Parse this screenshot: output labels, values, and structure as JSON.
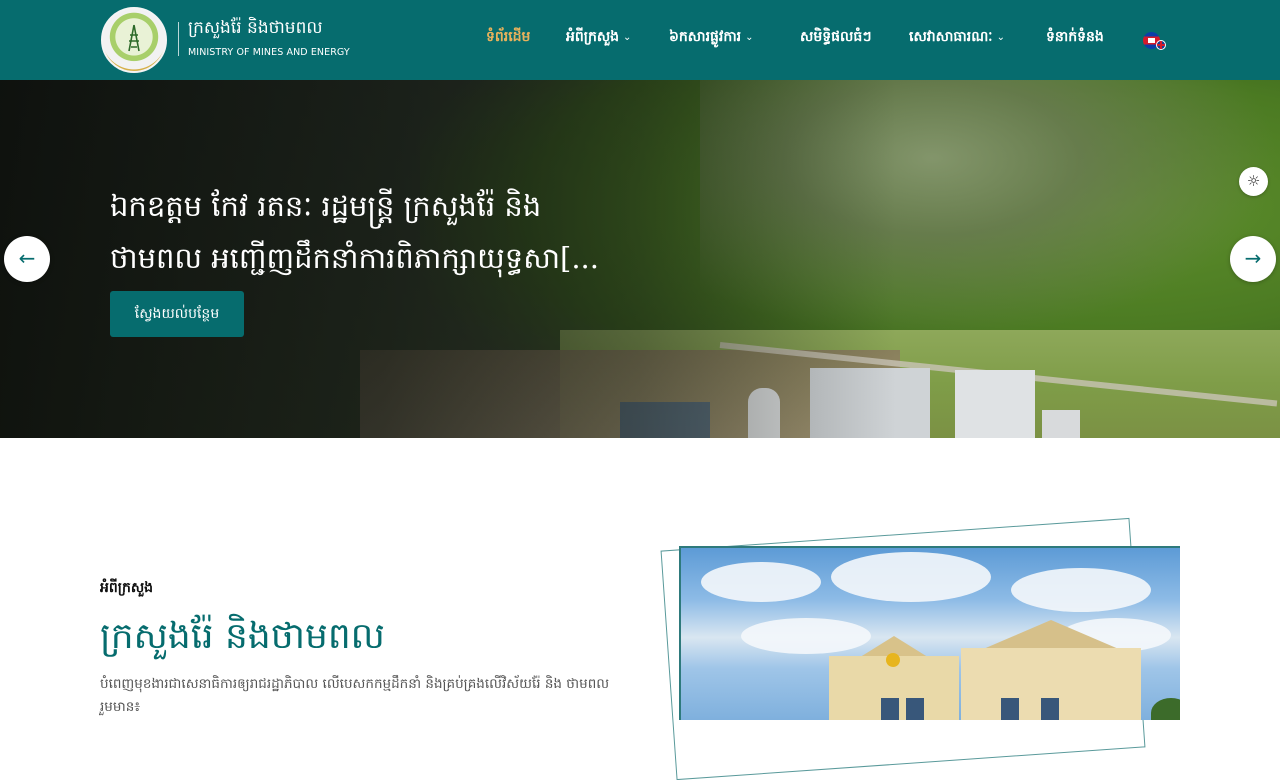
{
  "header": {
    "logo_kh": "ក្រសួងរ៉ែ និងថាមពល",
    "logo_en": "MINISTRY OF MINES AND ENERGY",
    "nav": [
      {
        "label": "ទំព័រដើម",
        "active": true,
        "dropdown": false
      },
      {
        "label": "អំពីក្រសួង",
        "active": false,
        "dropdown": true
      },
      {
        "label": "៦កសារផ្លូវការ",
        "active": false,
        "dropdown": true
      },
      {
        "label": "សមិទ្ធិផលធំៗ",
        "active": false,
        "dropdown": false
      },
      {
        "label": "សេវាសាធារណៈ",
        "active": false,
        "dropdown": true
      },
      {
        "label": "ទំនាក់ទំនង",
        "active": false,
        "dropdown": false
      }
    ],
    "language_icon": "cambodia-uk-flag-icon",
    "colors": {
      "primary": "#066c6e",
      "active_nav": "#e8b25c"
    }
  },
  "hero": {
    "title_line1": "ឯកឧត្តម កែវ រតនៈ រដ្ឋមន្ត្រី ក្រសួងរ៉ែ និង",
    "title_line2": "ថាមពល អញ្ជើញដឹកនាំការពិភាក្សាយុទ្ធសា[...",
    "button_label": "ស្វែងយល់បន្ថែម",
    "prev_icon": "←",
    "next_icon": "→",
    "theme_icon": "☼"
  },
  "about": {
    "label": "អំពីក្រសួង",
    "title": "ក្រសួងរ៉ែ និងថាមពល",
    "text": "បំពេញមុខងារជាសេនាធិការឲ្យរាជរដ្ឋាភិបាល លើបេសកកម្មដឹកនាំ និងគ្រប់គ្រងលើវិស័យរ៉ែ និង ថាមពលរួមមាន៖"
  }
}
